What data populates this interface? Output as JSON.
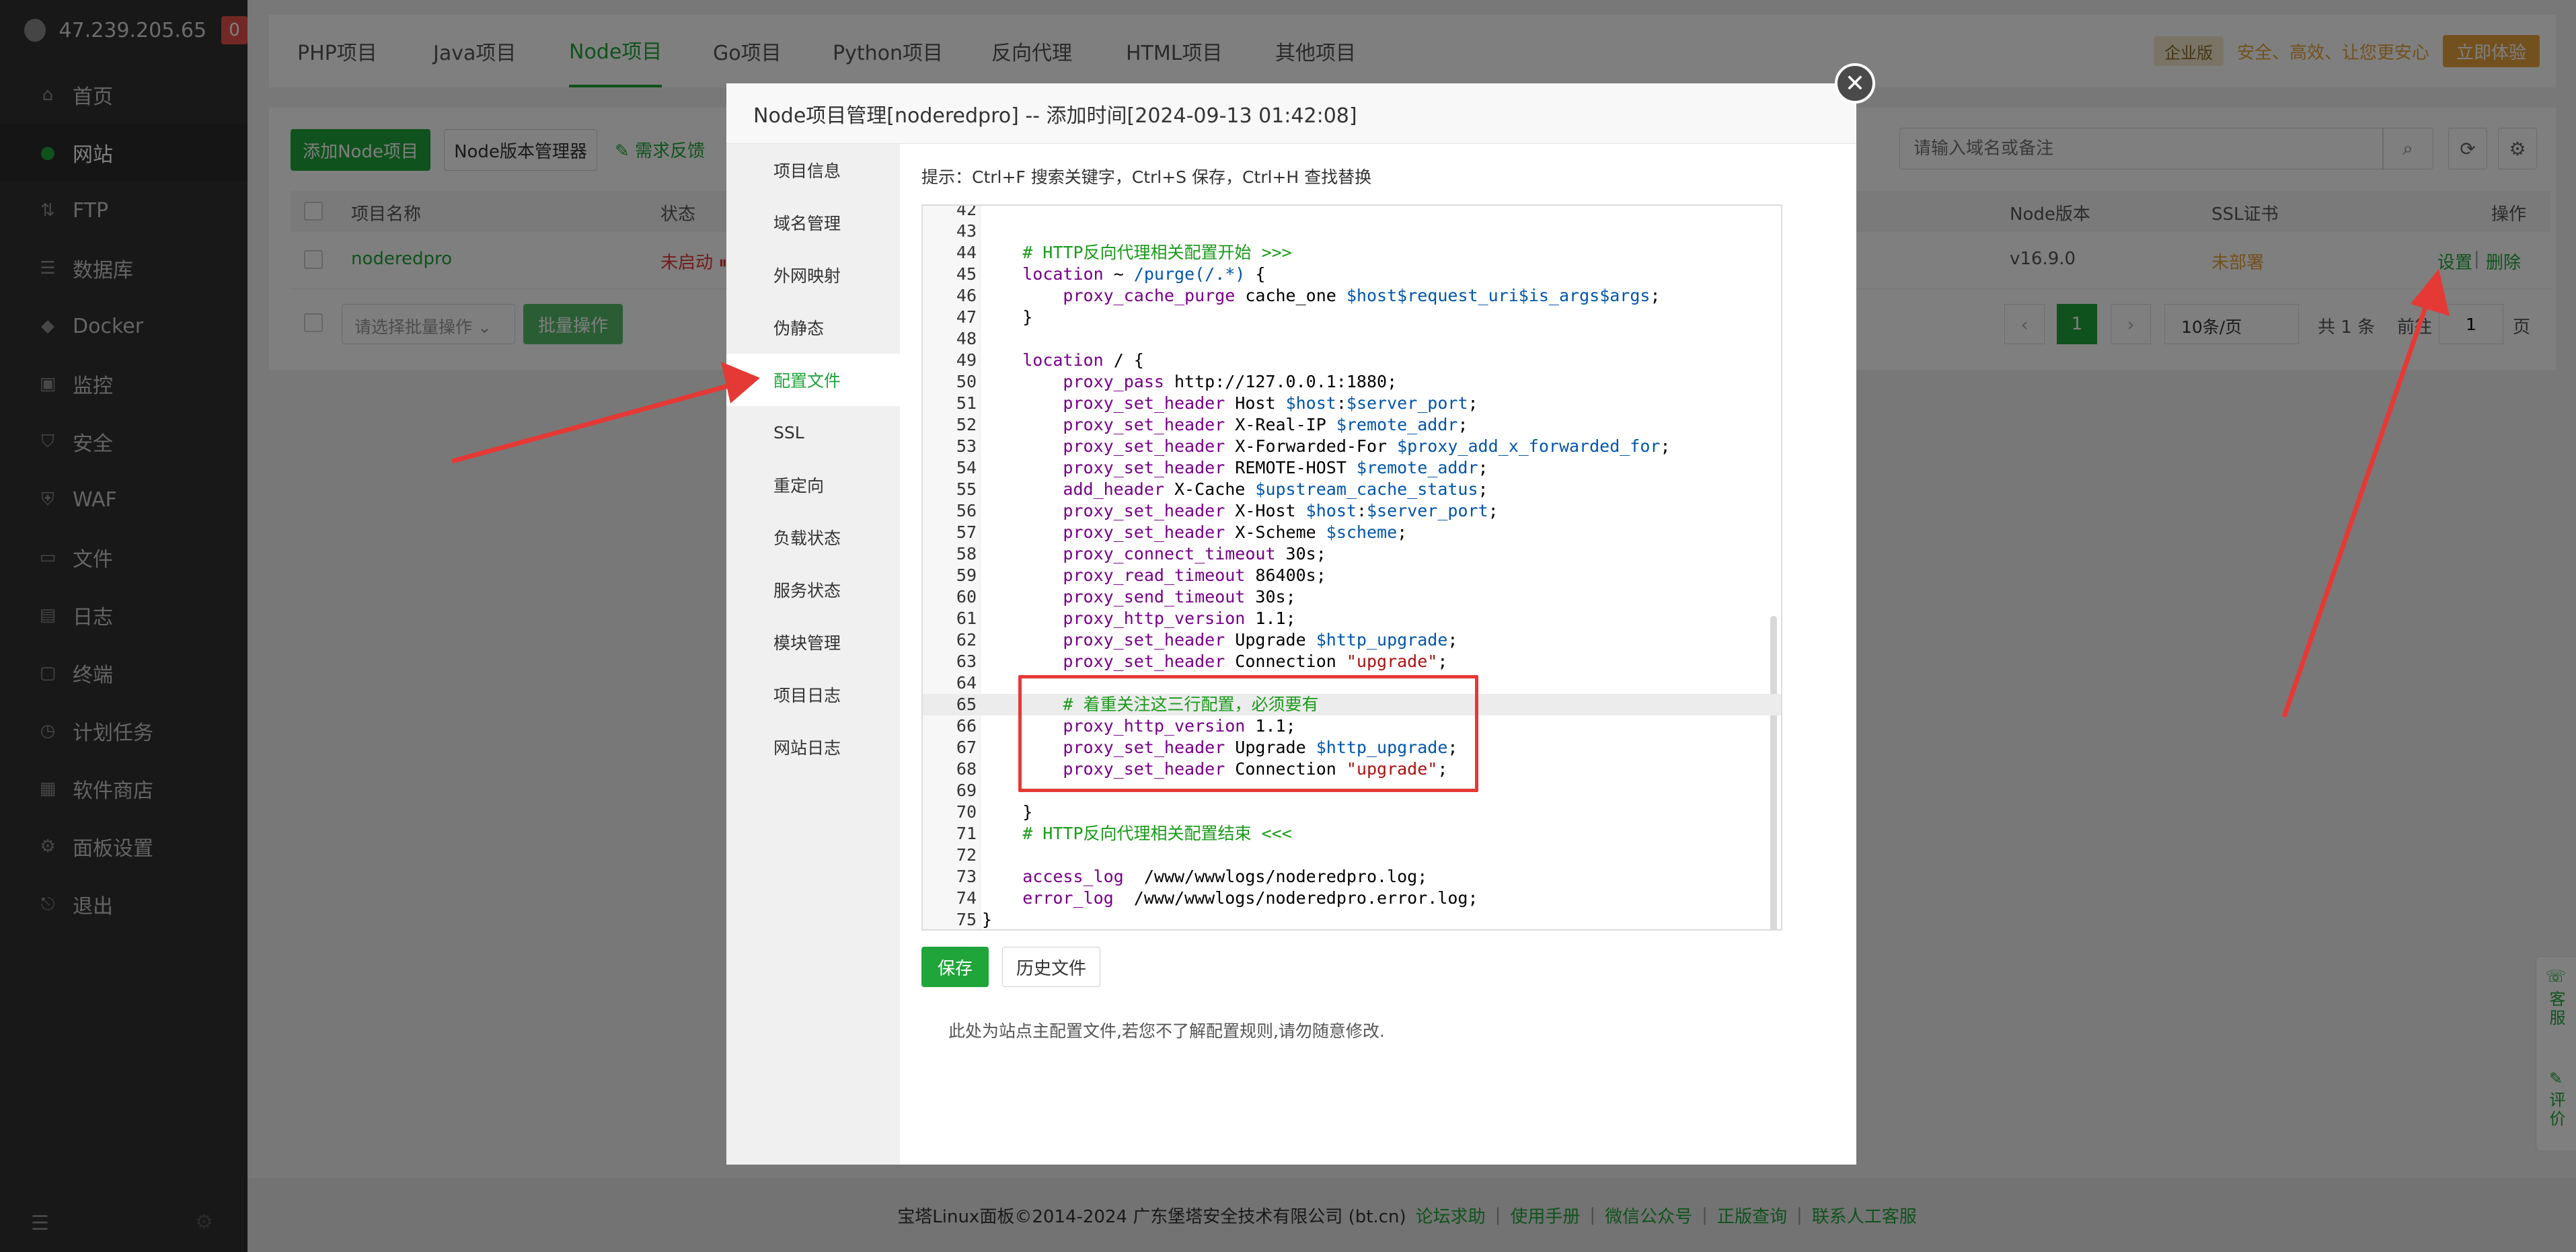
{
  "sidebar": {
    "ip": "47.239.205.65",
    "badge": "0",
    "items": [
      {
        "label": "首页",
        "icon": "home-icon",
        "glyph": "⌂"
      },
      {
        "label": "网站",
        "icon": "globe-icon",
        "glyph": "●"
      },
      {
        "label": "FTP",
        "icon": "ftp-icon",
        "glyph": "⇅"
      },
      {
        "label": "数据库",
        "icon": "database-icon",
        "glyph": "☰"
      },
      {
        "label": "Docker",
        "icon": "docker-icon",
        "glyph": "◆"
      },
      {
        "label": "监控",
        "icon": "monitor-icon",
        "glyph": "▣"
      },
      {
        "label": "安全",
        "icon": "shield-icon",
        "glyph": "⛉"
      },
      {
        "label": "WAF",
        "icon": "waf-icon",
        "glyph": "⛨"
      },
      {
        "label": "文件",
        "icon": "folder-icon",
        "glyph": "▭"
      },
      {
        "label": "日志",
        "icon": "log-icon",
        "glyph": "▤"
      },
      {
        "label": "终端",
        "icon": "terminal-icon",
        "glyph": "▢"
      },
      {
        "label": "计划任务",
        "icon": "clock-icon",
        "glyph": "◷"
      },
      {
        "label": "软件商店",
        "icon": "store-icon",
        "glyph": "▦"
      },
      {
        "label": "面板设置",
        "icon": "settings-icon",
        "glyph": "⚙"
      },
      {
        "label": "退出",
        "icon": "logout-icon",
        "glyph": "⎋"
      }
    ],
    "active": 1
  },
  "tabs": [
    "PHP项目",
    "Java项目",
    "Node项目",
    "Go项目",
    "Python项目",
    "反向代理",
    "HTML项目",
    "其他项目"
  ],
  "active_tab": 2,
  "promo": {
    "badge": "企业版",
    "text": "安全、高效、让您更安心",
    "button": "立即体验"
  },
  "toolbar": {
    "add_button": "添加Node项目",
    "version_button": "Node版本管理器",
    "feedback": "需求反馈",
    "search_placeholder": "请输入域名或备注"
  },
  "table": {
    "headers": {
      "name": "项目名称",
      "status": "状态",
      "node_version": "Node版本",
      "ssl": "SSL证书",
      "actions": "操作"
    },
    "row": {
      "name": "noderedpro",
      "status": "未启动",
      "node_version": "v16.9.0",
      "ssl": "未部署",
      "settings": "设置",
      "delete": "删除"
    },
    "batch_placeholder": "请选择批量操作",
    "batch_button": "批量操作",
    "pagination": {
      "page": "1",
      "page_size": "10条/页",
      "total": "共 1 条",
      "goto_label": "前往",
      "goto_value": "1",
      "page_unit": "页"
    }
  },
  "modal": {
    "title": "Node项目管理[noderedpro] -- 添加时间[2024-09-13 01:42:08]",
    "nav": [
      "项目信息",
      "域名管理",
      "外网映射",
      "伪静态",
      "配置文件",
      "SSL",
      "重定向",
      "负载状态",
      "服务状态",
      "模块管理",
      "项目日志",
      "网站日志"
    ],
    "active_nav": 4,
    "hint": "提示：Ctrl+F 搜索关键字，Ctrl+S 保存，Ctrl+H 查找替换",
    "save_button": "保存",
    "history_button": "历史文件",
    "note": "此处为站点主配置文件,若您不了解配置规则,请勿随意修改."
  },
  "code_lines": [
    {
      "n": "42",
      "t": ""
    },
    {
      "n": "43",
      "t": ""
    },
    {
      "n": "44",
      "t": "    # HTTP反向代理相关配置开始 >>>"
    },
    {
      "n": "45",
      "t": "    location ~ /purge(/.*) {"
    },
    {
      "n": "46",
      "t": "        proxy_cache_purge cache_one $host$request_uri$is_args$args;"
    },
    {
      "n": "47",
      "t": "    }"
    },
    {
      "n": "48",
      "t": ""
    },
    {
      "n": "49",
      "t": "    location / {"
    },
    {
      "n": "50",
      "t": "        proxy_pass http://127.0.0.1:1880;"
    },
    {
      "n": "51",
      "t": "        proxy_set_header Host $host:$server_port;"
    },
    {
      "n": "52",
      "t": "        proxy_set_header X-Real-IP $remote_addr;"
    },
    {
      "n": "53",
      "t": "        proxy_set_header X-Forwarded-For $proxy_add_x_forwarded_for;"
    },
    {
      "n": "54",
      "t": "        proxy_set_header REMOTE-HOST $remote_addr;"
    },
    {
      "n": "55",
      "t": "        add_header X-Cache $upstream_cache_status;"
    },
    {
      "n": "56",
      "t": "        proxy_set_header X-Host $host:$server_port;"
    },
    {
      "n": "57",
      "t": "        proxy_set_header X-Scheme $scheme;"
    },
    {
      "n": "58",
      "t": "        proxy_connect_timeout 30s;"
    },
    {
      "n": "59",
      "t": "        proxy_read_timeout 86400s;"
    },
    {
      "n": "60",
      "t": "        proxy_send_timeout 30s;"
    },
    {
      "n": "61",
      "t": "        proxy_http_version 1.1;"
    },
    {
      "n": "62",
      "t": "        proxy_set_header Upgrade $http_upgrade;"
    },
    {
      "n": "63",
      "t": "        proxy_set_header Connection \"upgrade\";"
    },
    {
      "n": "64",
      "t": ""
    },
    {
      "n": "65",
      "t": "        # 着重关注这三行配置，必须要有"
    },
    {
      "n": "66",
      "t": "        proxy_http_version 1.1;"
    },
    {
      "n": "67",
      "t": "        proxy_set_header Upgrade $http_upgrade;"
    },
    {
      "n": "68",
      "t": "        proxy_set_header Connection \"upgrade\";"
    },
    {
      "n": "69",
      "t": ""
    },
    {
      "n": "70",
      "t": "    }"
    },
    {
      "n": "71",
      "t": "    # HTTP反向代理相关配置结束 <<<"
    },
    {
      "n": "72",
      "t": ""
    },
    {
      "n": "73",
      "t": "    access_log  /www/wwwlogs/noderedpro.log;"
    },
    {
      "n": "74",
      "t": "    error_log  /www/wwwlogs/noderedpro.error.log;"
    },
    {
      "n": "75",
      "t": "}"
    }
  ],
  "highlight_line": "65",
  "footer": {
    "copyright": "宝塔Linux面板©2014-2024 广东堡塔安全技术有限公司 (bt.cn)",
    "links": [
      "论坛求助",
      "使用手册",
      "微信公众号",
      "正版查询",
      "联系人工客服"
    ]
  },
  "side_tools": {
    "service": "客服",
    "review": "评价"
  },
  "colors": {
    "accent": "#20a53a",
    "sidebar": "#313131",
    "warning": "#e6a23c",
    "danger": "#e53935"
  }
}
